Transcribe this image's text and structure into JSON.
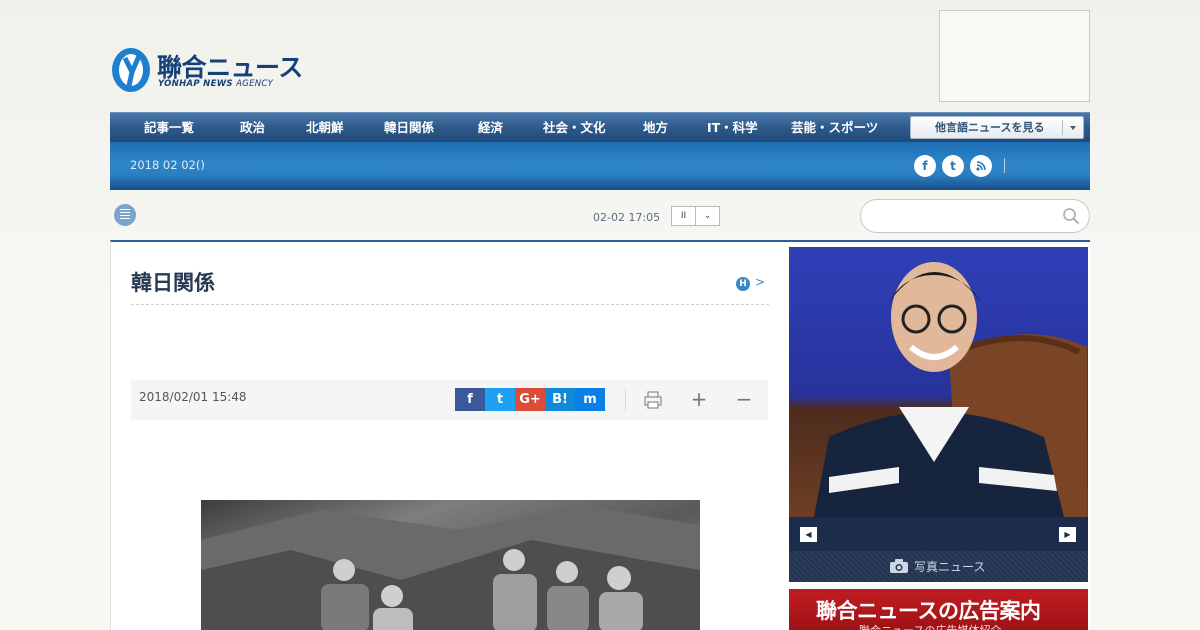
{
  "logo": {
    "name_ja": "聯合ニュース",
    "name_en": "YONHAP NEWS",
    "name_en_suffix": "AGENCY"
  },
  "nav": {
    "items": [
      "記事一覧",
      "政治",
      "北朝鮮",
      "韓日関係",
      "経済",
      "社会・文化",
      "地方",
      "IT・科学",
      "芸能・スポーツ"
    ],
    "language_select": "他言語ニュースを見る"
  },
  "subbar": {
    "date": "2018 02 02()"
  },
  "ticker": {
    "time": "02-02 17:05",
    "pause_label": "II",
    "next_label": "⌄"
  },
  "search": {
    "placeholder": ""
  },
  "article": {
    "section_title": "韓日関係",
    "home_badge": "H",
    "home_arrow": ">",
    "published": "2018/02/01 15:48",
    "share": [
      "f",
      "t",
      "G+",
      "B!",
      "m"
    ]
  },
  "sidebar": {
    "photo_news_label": "写真ニュース",
    "ad_title": "聯合ニュースの広告案内",
    "ad_subtitle": "聯合ニュースの広告媒体紹介"
  },
  "colors": {
    "brand_blue": "#15407a",
    "nav_blue": "#2d5a8a",
    "ad_red": "#c01d22"
  }
}
